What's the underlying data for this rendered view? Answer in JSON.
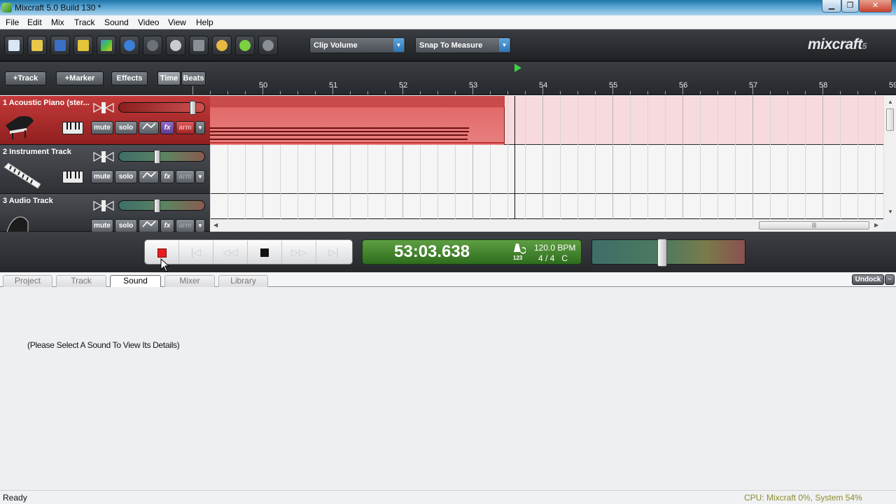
{
  "window": {
    "title": "Mixcraft 5.0 Build 130 *",
    "min": "▁",
    "max": "❐",
    "close": "✕"
  },
  "menu": [
    "File",
    "Edit",
    "Mix",
    "Track",
    "Sound",
    "Video",
    "View",
    "Help"
  ],
  "toolbar": {
    "clip_volume": "Clip Volume",
    "snap": "Snap To Measure",
    "logo": "mixcraft",
    "logo_version": "5"
  },
  "trackbar": {
    "add_track": "+Track",
    "add_marker": "+Marker",
    "effects": "Effects",
    "time": "Time",
    "beats": "Beats"
  },
  "ruler": {
    "marks": [
      "50",
      "51",
      "52",
      "53",
      "54",
      "55",
      "56",
      "57",
      "58",
      "59"
    ]
  },
  "tracks": [
    {
      "name": "1 Acoustic Piano (ster...",
      "mute": "mute",
      "solo": "solo",
      "fx": "fx",
      "arm": "arm",
      "armed": true,
      "volume": 0.9,
      "pan": 0.5
    },
    {
      "name": "2 Instrument Track",
      "mute": "mute",
      "solo": "solo",
      "fx": "fx",
      "arm": "arm",
      "armed": false,
      "volume": 0.45,
      "pan": 0.5
    },
    {
      "name": "3 Audio Track",
      "mute": "mute",
      "solo": "solo",
      "fx": "fx",
      "arm": "arm",
      "armed": false,
      "volume": 0.45,
      "pan": 0.5
    }
  ],
  "transport": {
    "time": "53:03.638",
    "bpm": "120.0 BPM",
    "signature": "4 / 4",
    "key": "C",
    "metronome": "123",
    "master_volume": 0.45
  },
  "tabs": [
    {
      "label": "Project",
      "active": false
    },
    {
      "label": "Track",
      "active": false
    },
    {
      "label": "Sound",
      "active": true
    },
    {
      "label": "Mixer",
      "active": false
    },
    {
      "label": "Library",
      "active": false
    }
  ],
  "undock": "Undock",
  "panel": {
    "message": "(Please Select A Sound To View Its Details)"
  },
  "status": {
    "left": "Ready",
    "right": "CPU: Mixcraft 0%, System 54%"
  },
  "colors": {
    "armed_track": "#c53a3a",
    "lcd": "#4a8a33",
    "record": "#e81c1c"
  }
}
